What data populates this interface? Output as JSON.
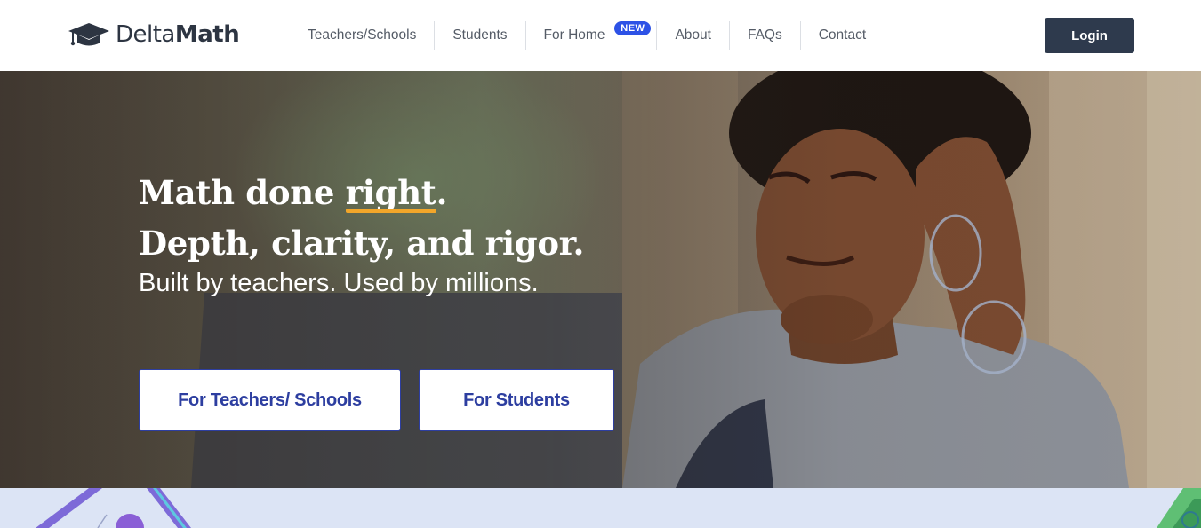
{
  "brand": {
    "logo_light": "Delta",
    "logo_bold": "Math",
    "text_color": "#2d3542"
  },
  "nav": {
    "items": [
      {
        "label": "Teachers/Schools"
      },
      {
        "label": "Students"
      },
      {
        "label": "For Home",
        "badge": "NEW"
      },
      {
        "label": "About"
      },
      {
        "label": "FAQs"
      },
      {
        "label": "Contact"
      }
    ],
    "badge_color": "#2d52e6"
  },
  "login": {
    "label": "Login",
    "color": "#2e3a4d"
  },
  "hero": {
    "headline_1_prefix": "Math done ",
    "headline_1_highlight": "right",
    "headline_1_suffix": ".",
    "headline_2": "Depth, clarity, and rigor.",
    "subline": "Built by teachers. Used by millions.",
    "highlight_color": "#f2a62a",
    "cta_teachers": "For Teachers/ Schools",
    "cta_students": "For Students",
    "cta_color": "#2d3ea0"
  },
  "icons": {
    "logo": "graduation-cap-icon"
  }
}
